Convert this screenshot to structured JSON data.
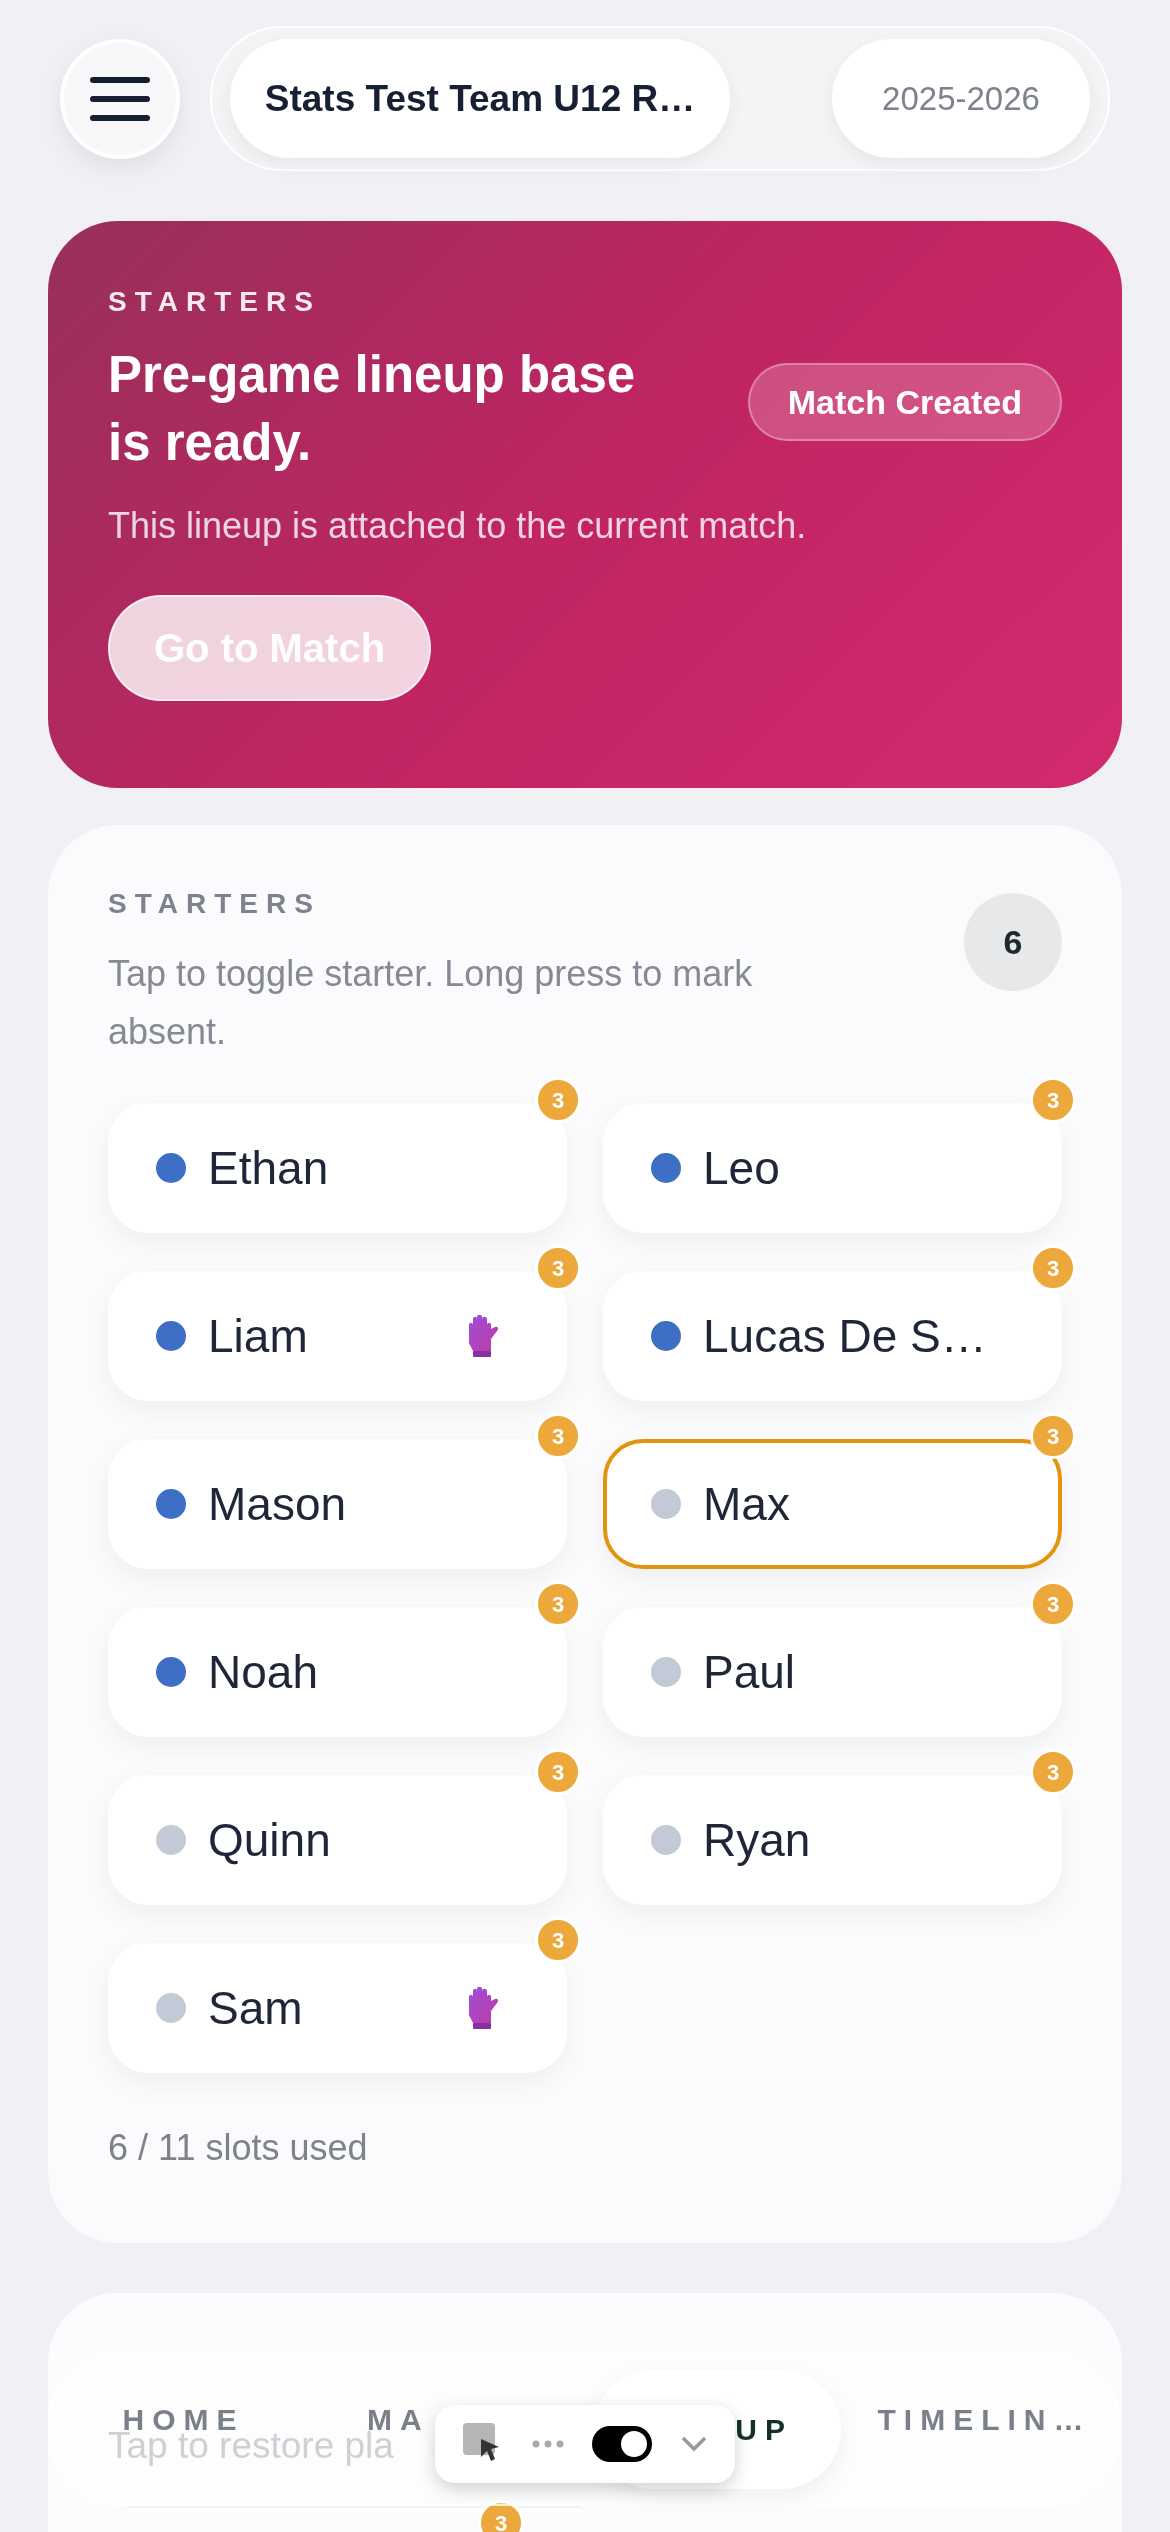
{
  "header": {
    "team": "Stats Test Team U12 R…",
    "season": "2025-2026"
  },
  "hero": {
    "eyebrow": "STARTERS",
    "title": "Pre-game lineup base is ready.",
    "status": "Match Created",
    "description": "This lineup is attached to the current match.",
    "button": "Go to Match"
  },
  "starters": {
    "eyebrow": "STARTERS",
    "count": "6",
    "hint": "Tap to toggle starter. Long press to mark absent.",
    "footer": "6 / 11 slots used",
    "players": [
      {
        "name": "Ethan",
        "starter": true,
        "selected": false,
        "badge": "3",
        "goalkeeper": false
      },
      {
        "name": "Leo",
        "starter": true,
        "selected": false,
        "badge": "3",
        "goalkeeper": false
      },
      {
        "name": "Liam",
        "starter": true,
        "selected": false,
        "badge": "3",
        "goalkeeper": true
      },
      {
        "name": "Lucas De S…",
        "starter": true,
        "selected": false,
        "badge": "3",
        "goalkeeper": false
      },
      {
        "name": "Mason",
        "starter": true,
        "selected": false,
        "badge": "3",
        "goalkeeper": false
      },
      {
        "name": "Max",
        "starter": false,
        "selected": true,
        "badge": "3",
        "goalkeeper": false
      },
      {
        "name": "Noah",
        "starter": true,
        "selected": false,
        "badge": "3",
        "goalkeeper": false
      },
      {
        "name": "Paul",
        "starter": false,
        "selected": false,
        "badge": "3",
        "goalkeeper": false
      },
      {
        "name": "Quinn",
        "starter": false,
        "selected": false,
        "badge": "3",
        "goalkeeper": false
      },
      {
        "name": "Ryan",
        "starter": false,
        "selected": false,
        "badge": "3",
        "goalkeeper": false
      },
      {
        "name": "Sam",
        "starter": false,
        "selected": false,
        "badge": "3",
        "goalkeeper": true
      }
    ]
  },
  "bench": {
    "hint": "Tap to restore pla",
    "badge": "3"
  },
  "nav": [
    {
      "label": "HOME",
      "selected": false
    },
    {
      "label": "MA",
      "selected": false
    },
    {
      "label": "UP",
      "selected": true
    },
    {
      "label": "TIMELIN…",
      "selected": false
    }
  ],
  "devtools": {
    "toggle_on": true
  }
}
